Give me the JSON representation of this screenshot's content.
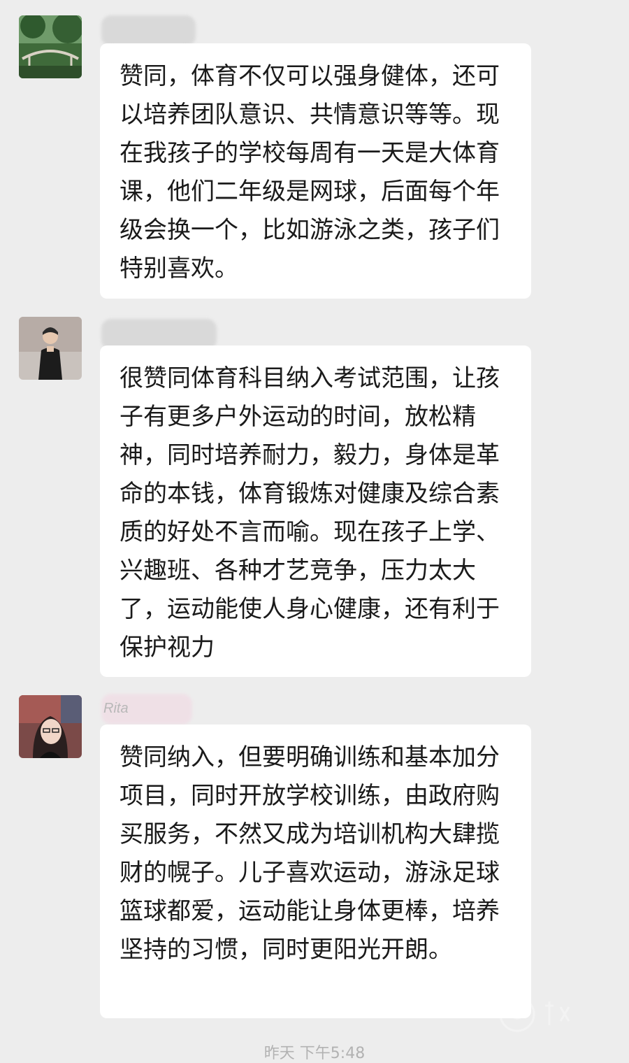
{
  "messages": [
    {
      "sender": "",
      "text": "赞同，体育不仅可以强身健体，还可以培养团队意识、共情意识等等。现在我孩子的学校每周有一天是大体育课，他们二年级是网球，后面每个年级会换一个，比如游泳之类，孩子们特别喜欢。"
    },
    {
      "sender": "",
      "text": "很赞同体育科目纳入考试范围，让孩子有更多户外运动的时间，放松精神，同时培养耐力，毅力，身体是革命的本钱，体育锻炼对健康及综合素质的好处不言而喻。现在孩子上学、兴趣班、各种才艺竞争，压力太大了，运动能使人身心健康，还有利于保护视力"
    },
    {
      "sender": "Rita",
      "text": "赞同纳入，但要明确训练和基本加分项目，同时开放学校训练，由政府购买服务，不然又成为培训机构大肆揽财的幌子。儿子喜欢运动，游泳足球篮球都爱，运动能让身体更棒，培养坚持的习惯，同时更阳光开朗。"
    }
  ],
  "footer": {
    "timestamp": "昨天 下午5:48"
  }
}
